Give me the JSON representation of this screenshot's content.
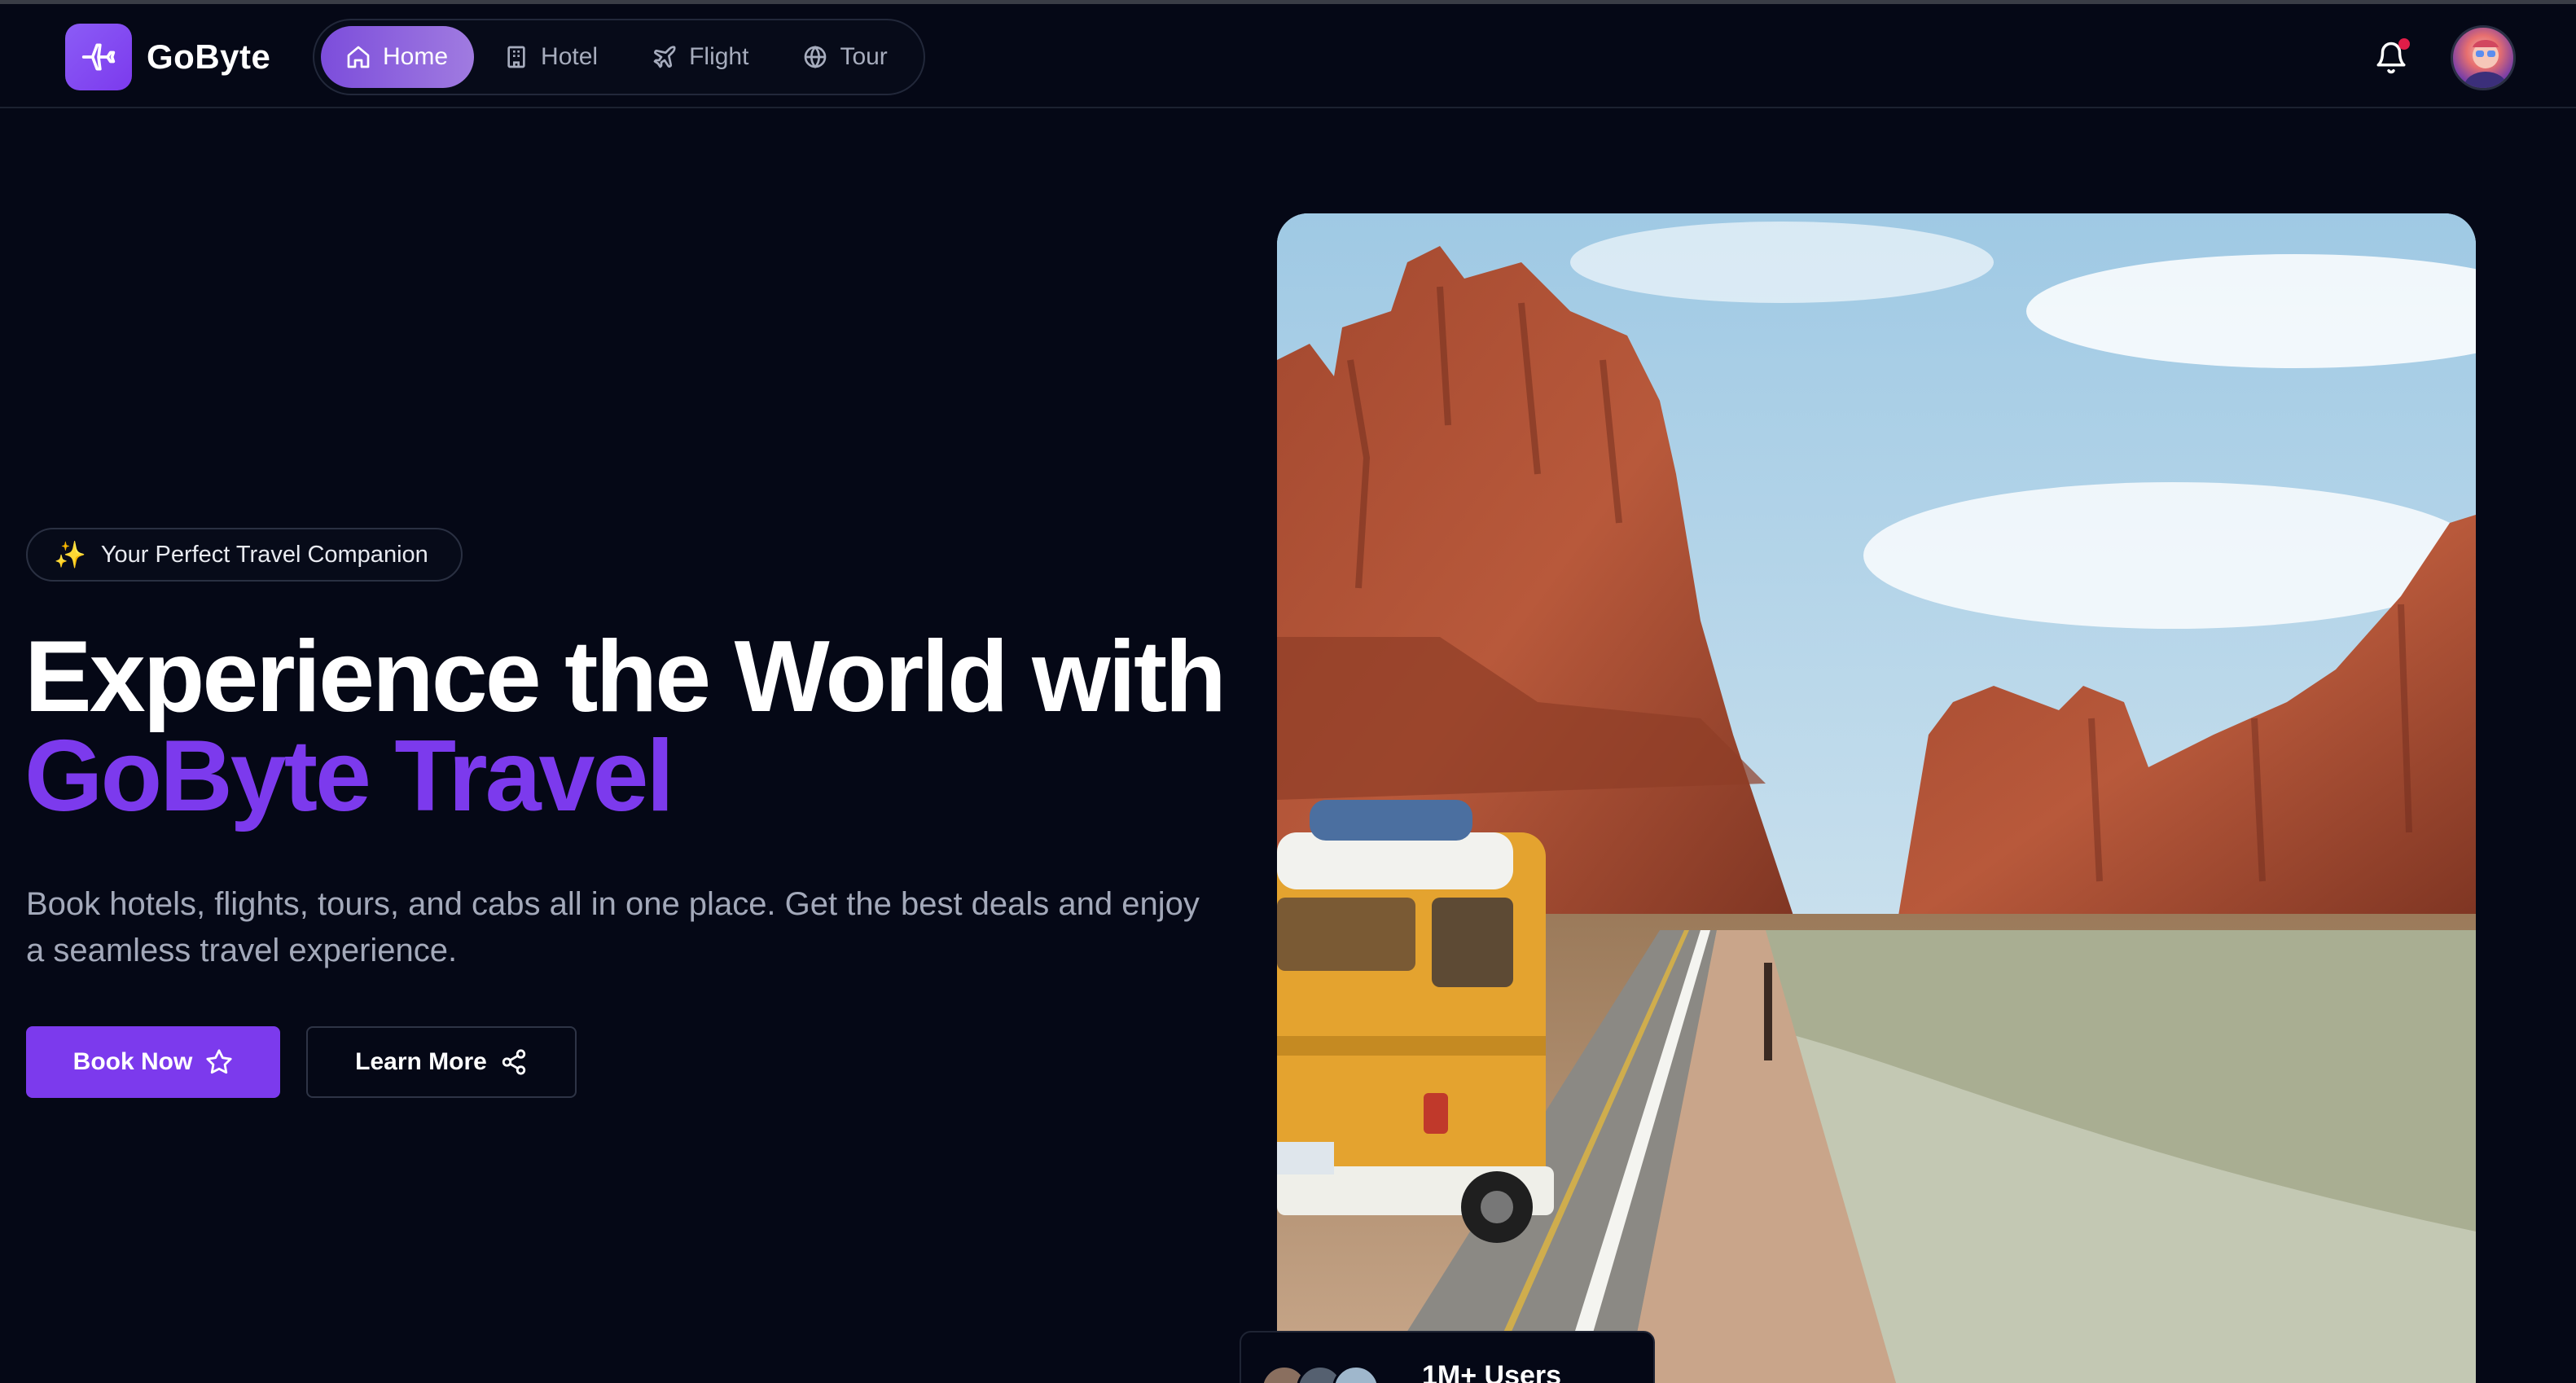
{
  "brand": {
    "name": "GoByte",
    "logo_icon": "plane-icon",
    "logo_color": "#7c3aed"
  },
  "nav": {
    "items": [
      {
        "label": "Home",
        "icon": "home-icon",
        "active": true
      },
      {
        "label": "Hotel",
        "icon": "building-icon",
        "active": false
      },
      {
        "label": "Flight",
        "icon": "plane-icon",
        "active": false
      },
      {
        "label": "Tour",
        "icon": "globe-icon",
        "active": false
      }
    ]
  },
  "header_actions": {
    "notification_icon": "bell-icon",
    "has_unread": true,
    "avatar": "user-avatar"
  },
  "hero": {
    "badge": {
      "icon": "sparkles",
      "emoji": "✨",
      "text": "Your Perfect Travel Companion"
    },
    "title_line1": "Experience the World with",
    "title_line2": "GoByte Travel",
    "subtitle": "Book hotels, flights, tours, and cabs all in one place. Get the best deals and enjoy a seamless travel experience.",
    "primary_button": {
      "label": "Book Now",
      "icon": "star-icon"
    },
    "secondary_button": {
      "label": "Learn More",
      "icon": "share-icon"
    }
  },
  "stats_card": {
    "count_text": "1M+ Users"
  },
  "colors": {
    "accent": "#7c3aed",
    "background": "#050816",
    "muted_text": "#a3a9ba"
  }
}
